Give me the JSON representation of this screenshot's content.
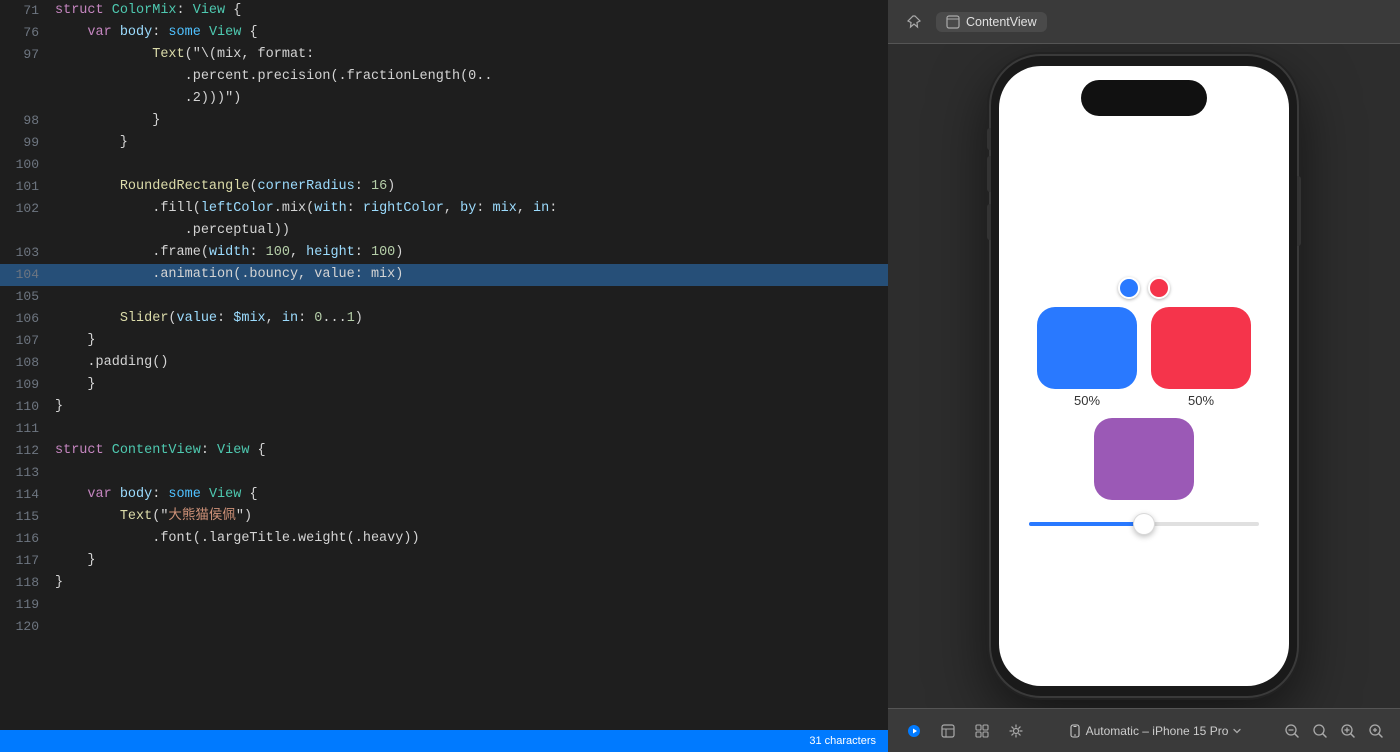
{
  "editor": {
    "lines": [
      {
        "num": "71",
        "tokens": [
          {
            "t": "kw",
            "v": "struct "
          },
          {
            "t": "type",
            "v": "ColorMix"
          },
          {
            "t": "plain",
            "v": ": "
          },
          {
            "t": "type",
            "v": "View"
          },
          {
            "t": "plain",
            "v": " {"
          }
        ]
      },
      {
        "num": "76",
        "tokens": [
          {
            "t": "plain",
            "v": "    "
          },
          {
            "t": "kw",
            "v": "var "
          },
          {
            "t": "prop",
            "v": "body"
          },
          {
            "t": "plain",
            "v": ": "
          },
          {
            "t": "kw2",
            "v": "some "
          },
          {
            "t": "type",
            "v": "View"
          },
          {
            "t": "plain",
            "v": " {"
          }
        ]
      },
      {
        "num": "97",
        "tokens": [
          {
            "t": "plain",
            "v": "            "
          },
          {
            "t": "fn",
            "v": "Text"
          },
          {
            "t": "plain",
            "v": "(\"\\(mix, format:"
          },
          {
            "t": "plain",
            "v": ""
          }
        ]
      },
      {
        "num": "",
        "tokens": [
          {
            "t": "plain",
            "v": "                .percent.precision(.fractionLength(0.."
          }
        ]
      },
      {
        "num": "",
        "tokens": [
          {
            "t": "plain",
            "v": "                .2)))\")"
          }
        ]
      },
      {
        "num": "98",
        "tokens": [
          {
            "t": "plain",
            "v": "            }"
          }
        ]
      },
      {
        "num": "99",
        "tokens": [
          {
            "t": "plain",
            "v": "        }"
          }
        ]
      },
      {
        "num": "100",
        "tokens": [
          {
            "t": "plain",
            "v": ""
          }
        ]
      },
      {
        "num": "101",
        "tokens": [
          {
            "t": "plain",
            "v": "        "
          },
          {
            "t": "fn",
            "v": "RoundedRectangle"
          },
          {
            "t": "plain",
            "v": "("
          },
          {
            "t": "prop",
            "v": "cornerRadius"
          },
          {
            "t": "plain",
            "v": ": "
          },
          {
            "t": "num",
            "v": "16"
          },
          {
            "t": "plain",
            "v": ")"
          }
        ]
      },
      {
        "num": "102",
        "tokens": [
          {
            "t": "plain",
            "v": "            .fill("
          },
          {
            "t": "prop",
            "v": "leftColor"
          },
          {
            "t": "plain",
            "v": ".mix("
          },
          {
            "t": "prop",
            "v": "with"
          },
          {
            "t": "plain",
            "v": ": "
          },
          {
            "t": "prop",
            "v": "rightColor"
          },
          {
            "t": "plain",
            "v": ", "
          },
          {
            "t": "prop",
            "v": "by"
          },
          {
            "t": "plain",
            "v": ": "
          },
          {
            "t": "prop",
            "v": "mix"
          },
          {
            "t": "plain",
            "v": ", "
          },
          {
            "t": "prop",
            "v": "in"
          },
          {
            "t": "plain",
            "v": ":"
          }
        ]
      },
      {
        "num": "",
        "tokens": [
          {
            "t": "plain",
            "v": "                .perceptual))"
          }
        ]
      },
      {
        "num": "103",
        "tokens": [
          {
            "t": "plain",
            "v": "            .frame("
          },
          {
            "t": "prop",
            "v": "width"
          },
          {
            "t": "plain",
            "v": ": "
          },
          {
            "t": "num",
            "v": "100"
          },
          {
            "t": "plain",
            "v": ", "
          },
          {
            "t": "prop",
            "v": "height"
          },
          {
            "t": "plain",
            "v": ": "
          },
          {
            "t": "num",
            "v": "100"
          },
          {
            "t": "plain",
            "v": ")"
          }
        ]
      },
      {
        "num": "104",
        "tokens": [
          {
            "t": "plain",
            "v": "            .animation(.bouncy, value: mix)"
          }
        ],
        "highlighted": true
      },
      {
        "num": "105",
        "tokens": [
          {
            "t": "plain",
            "v": ""
          }
        ]
      },
      {
        "num": "106",
        "tokens": [
          {
            "t": "plain",
            "v": "        "
          },
          {
            "t": "fn",
            "v": "Slider"
          },
          {
            "t": "plain",
            "v": "("
          },
          {
            "t": "prop",
            "v": "value"
          },
          {
            "t": "plain",
            "v": ": "
          },
          {
            "t": "prop",
            "v": "$mix"
          },
          {
            "t": "plain",
            "v": ", "
          },
          {
            "t": "prop",
            "v": "in"
          },
          {
            "t": "plain",
            "v": ": "
          },
          {
            "t": "num",
            "v": "0"
          },
          {
            "t": "plain",
            "v": "..."
          },
          {
            "t": "num",
            "v": "1"
          },
          {
            "t": "plain",
            "v": ")"
          }
        ]
      },
      {
        "num": "107",
        "tokens": [
          {
            "t": "plain",
            "v": "    }"
          }
        ]
      },
      {
        "num": "108",
        "tokens": [
          {
            "t": "plain",
            "v": "    .padding()"
          }
        ]
      },
      {
        "num": "109",
        "tokens": [
          {
            "t": "plain",
            "v": "    }"
          }
        ]
      },
      {
        "num": "110",
        "tokens": [
          {
            "t": "plain",
            "v": "}"
          }
        ]
      },
      {
        "num": "111",
        "tokens": [
          {
            "t": "plain",
            "v": ""
          }
        ]
      },
      {
        "num": "112",
        "tokens": [
          {
            "t": "kw",
            "v": "struct "
          },
          {
            "t": "type",
            "v": "ContentView"
          },
          {
            "t": "plain",
            "v": ": "
          },
          {
            "t": "type",
            "v": "View"
          },
          {
            "t": "plain",
            "v": " {"
          }
        ]
      },
      {
        "num": "113",
        "tokens": [
          {
            "t": "plain",
            "v": ""
          }
        ]
      },
      {
        "num": "114",
        "tokens": [
          {
            "t": "plain",
            "v": "    "
          },
          {
            "t": "kw",
            "v": "var "
          },
          {
            "t": "prop",
            "v": "body"
          },
          {
            "t": "plain",
            "v": ": "
          },
          {
            "t": "kw2",
            "v": "some "
          },
          {
            "t": "type",
            "v": "View"
          },
          {
            "t": "plain",
            "v": " {"
          }
        ]
      },
      {
        "num": "115",
        "tokens": [
          {
            "t": "plain",
            "v": "        "
          },
          {
            "t": "fn",
            "v": "Text"
          },
          {
            "t": "plain",
            "v": "(\""
          },
          {
            "t": "str",
            "v": "大熊猫侯佩"
          },
          {
            "t": "plain",
            "v": "\")"
          }
        ]
      },
      {
        "num": "116",
        "tokens": [
          {
            "t": "plain",
            "v": "            .font(.largeTitle.weight(.heavy))"
          }
        ]
      },
      {
        "num": "117",
        "tokens": [
          {
            "t": "plain",
            "v": "    }"
          }
        ]
      },
      {
        "num": "118",
        "tokens": [
          {
            "t": "plain",
            "v": "}"
          }
        ]
      },
      {
        "num": "119",
        "tokens": [
          {
            "t": "plain",
            "v": ""
          }
        ]
      },
      {
        "num": "120",
        "tokens": [
          {
            "t": "plain",
            "v": ""
          }
        ]
      }
    ]
  },
  "preview": {
    "toolbar": {
      "content_view_label": "ContentView"
    },
    "device": {
      "left_pct": "50%",
      "right_pct": "50%"
    },
    "bottom": {
      "device_label": "Automatic – iPhone 15 Pro",
      "chars_label": "31 characters"
    }
  }
}
